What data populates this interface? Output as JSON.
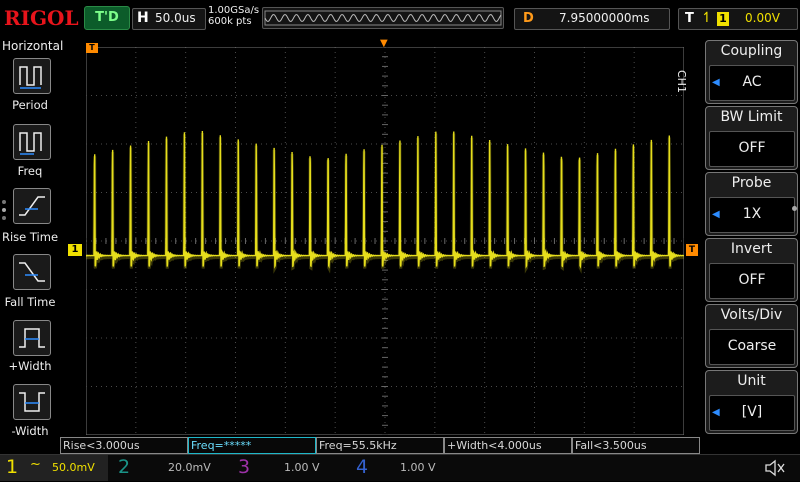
{
  "top": {
    "logo": "RIGOL",
    "run_state": "T'D",
    "horizontal_label": "H",
    "timebase": "50.0us",
    "sample_rate": "1.00GSa/s",
    "memory_depth": "600k pts",
    "delay_label": "D",
    "delay_value": "7.95000000ms",
    "trigger_label": "T",
    "trigger_channel": "1",
    "trigger_level": "0.00V"
  },
  "left_menu": {
    "title": "Horizontal",
    "items": [
      {
        "label": "Period",
        "icon": "period-icon"
      },
      {
        "label": "Freq",
        "icon": "frequency-icon"
      },
      {
        "label": "Rise Time",
        "icon": "rise-time-icon"
      },
      {
        "label": "Fall Time",
        "icon": "fall-time-icon"
      },
      {
        "label": "+Width",
        "icon": "positive-width-icon"
      },
      {
        "label": "-Width",
        "icon": "negative-width-icon"
      }
    ]
  },
  "right_menu": {
    "channel_tag": "CH1",
    "items": [
      {
        "title": "Coupling",
        "value": "AC",
        "has_arrow": true
      },
      {
        "title": "BW Limit",
        "value": "OFF",
        "has_arrow": false
      },
      {
        "title": "Probe",
        "value": "1X",
        "has_arrow": true
      },
      {
        "title": "Invert",
        "value": "OFF",
        "has_arrow": false
      },
      {
        "title": "Volts/Div",
        "value": "Coarse",
        "has_arrow": false
      },
      {
        "title": "Unit",
        "value": "[V]",
        "has_arrow": true
      }
    ]
  },
  "markers": {
    "trigger_position": "T",
    "channel_ref": "1",
    "trigger_level": "T"
  },
  "measurements": [
    {
      "text": "Rise<3.000us",
      "highlight": false
    },
    {
      "text": "Freq=*****",
      "highlight": true
    },
    {
      "text": "Freq=55.5kHz",
      "highlight": false
    },
    {
      "text": "+Width<4.000us",
      "highlight": false
    },
    {
      "text": "Fall<3.500us",
      "highlight": false
    }
  ],
  "channels": [
    {
      "num": "1",
      "coupling_symbol": "~",
      "scale": "50.0mV",
      "active": true,
      "color": "#f0e000"
    },
    {
      "num": "2",
      "scale": "20.0mV",
      "active": false,
      "color": "#1fb7a8"
    },
    {
      "num": "3",
      "scale": "1.00 V",
      "active": false,
      "color": "#c23bd0"
    },
    {
      "num": "4",
      "scale": "1.00 V",
      "active": false,
      "color": "#3f77ff"
    }
  ],
  "colors": {
    "ch1": "#e6de1c",
    "grid": "#4a4a4a",
    "marker_orange": "#ff8a00",
    "accent_blue": "#2d8cff"
  },
  "waveform": {
    "frequency_hz": 55500,
    "timebase_per_div_us": 50,
    "vertical_scale_per_div_mv": 50,
    "baseline_mv": -15,
    "peak_mv": 115,
    "pulse_count_visible": 27
  }
}
